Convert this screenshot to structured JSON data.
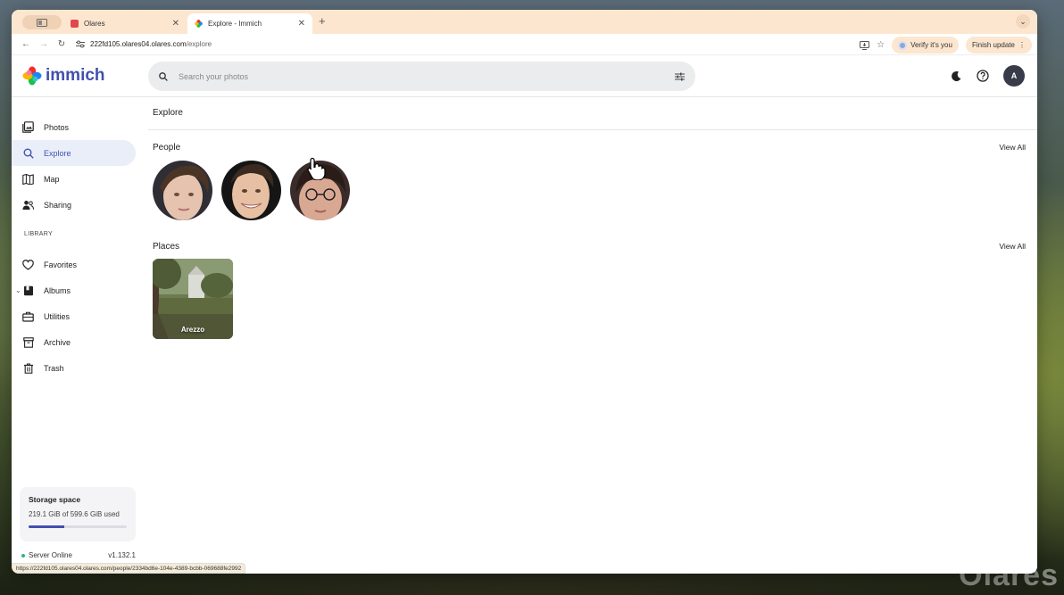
{
  "browser": {
    "tabs": [
      {
        "label": "Olares",
        "active": false,
        "favicon_color": "#e0484a"
      },
      {
        "label": "Explore - Immich",
        "active": true,
        "favicon_color": "multicolor"
      }
    ],
    "url_host": "222fd105.olares04.olares.com",
    "url_path": "/explore",
    "verify_label": "Verify it's you",
    "finish_update_label": "Finish update",
    "status_url": "https://222fd105.olares04.olares.com/people/2334bd6e-104e-4389-bcbb-069688fe2992"
  },
  "app": {
    "logo_text": "immich",
    "search_placeholder": "Search your photos",
    "avatar_initial": "A",
    "accent": "#4250af"
  },
  "sidebar": {
    "items": [
      {
        "label": "Photos",
        "icon": "photos-icon",
        "active": false
      },
      {
        "label": "Explore",
        "icon": "search-icon",
        "active": true
      },
      {
        "label": "Map",
        "icon": "map-icon",
        "active": false
      },
      {
        "label": "Sharing",
        "icon": "sharing-icon",
        "active": false
      }
    ],
    "library_label": "LIBRARY",
    "library_items": [
      {
        "label": "Favorites",
        "icon": "heart-icon"
      },
      {
        "label": "Albums",
        "icon": "albums-icon"
      },
      {
        "label": "Utilities",
        "icon": "toolbox-icon"
      },
      {
        "label": "Archive",
        "icon": "archive-icon"
      },
      {
        "label": "Trash",
        "icon": "trash-icon"
      }
    ],
    "storage": {
      "title": "Storage space",
      "used_text": "219.1 GiB of 599.6 GiB used",
      "used_fraction": 0.365
    },
    "server_status": "Server Online",
    "version": "v1.132.1"
  },
  "main": {
    "page_title": "Explore",
    "people_title": "People",
    "places_title": "Places",
    "view_all_label": "View All",
    "places": [
      {
        "label": "Arezzo"
      }
    ]
  },
  "watermark": "Olares"
}
